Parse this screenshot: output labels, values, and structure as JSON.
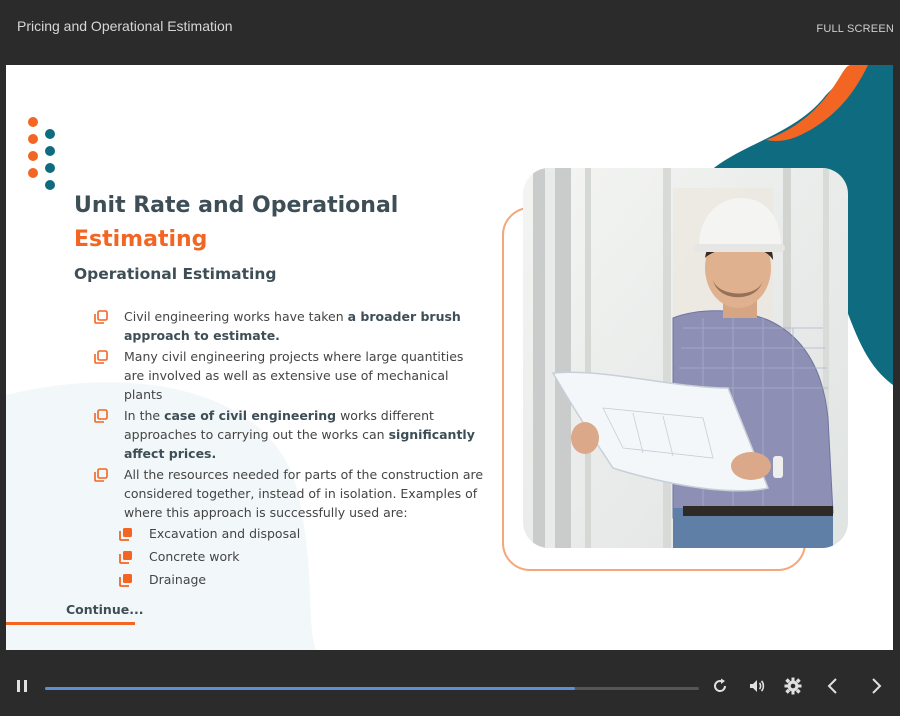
{
  "header": {
    "title": "Pricing and Operational Estimation",
    "fullscreen_label": "FULL SCREEN"
  },
  "slide": {
    "heading_line1": "Unit Rate and Operational",
    "heading_line2": "Estimating",
    "subheading": "Operational Estimating",
    "bullets": [
      {
        "pre": "Civil engineering works have taken ",
        "bold": "a broader brush approach to estimate.",
        "post": ""
      },
      {
        "text": "Many civil engineering projects where large quantities are involved as well as extensive use of mechanical plants"
      },
      {
        "pre": "In the ",
        "bold1": "case of civil engineering",
        "mid": " works different approaches to carrying out the works can ",
        "bold2": "significantly affect prices.",
        "post": ""
      },
      {
        "text": "All the resources needed for parts of the construction are considered together, instead of in isolation. Examples of where this approach is successfully used are:"
      }
    ],
    "sub_bullets": [
      "Excavation and disposal",
      "Concrete work",
      "Drainage"
    ],
    "continue_label": "Continue..."
  },
  "player": {
    "progress": 0.81
  },
  "colors": {
    "accent_orange": "#f26522",
    "teal": "#0f6b80",
    "heading": "#3e4e57",
    "progress_blue": "#5b8fd6"
  },
  "icons": [
    "pause-icon",
    "replay-icon",
    "volume-icon",
    "settings-gear-icon",
    "previous-arrow-icon",
    "next-arrow-icon",
    "bullet-square-icon"
  ]
}
